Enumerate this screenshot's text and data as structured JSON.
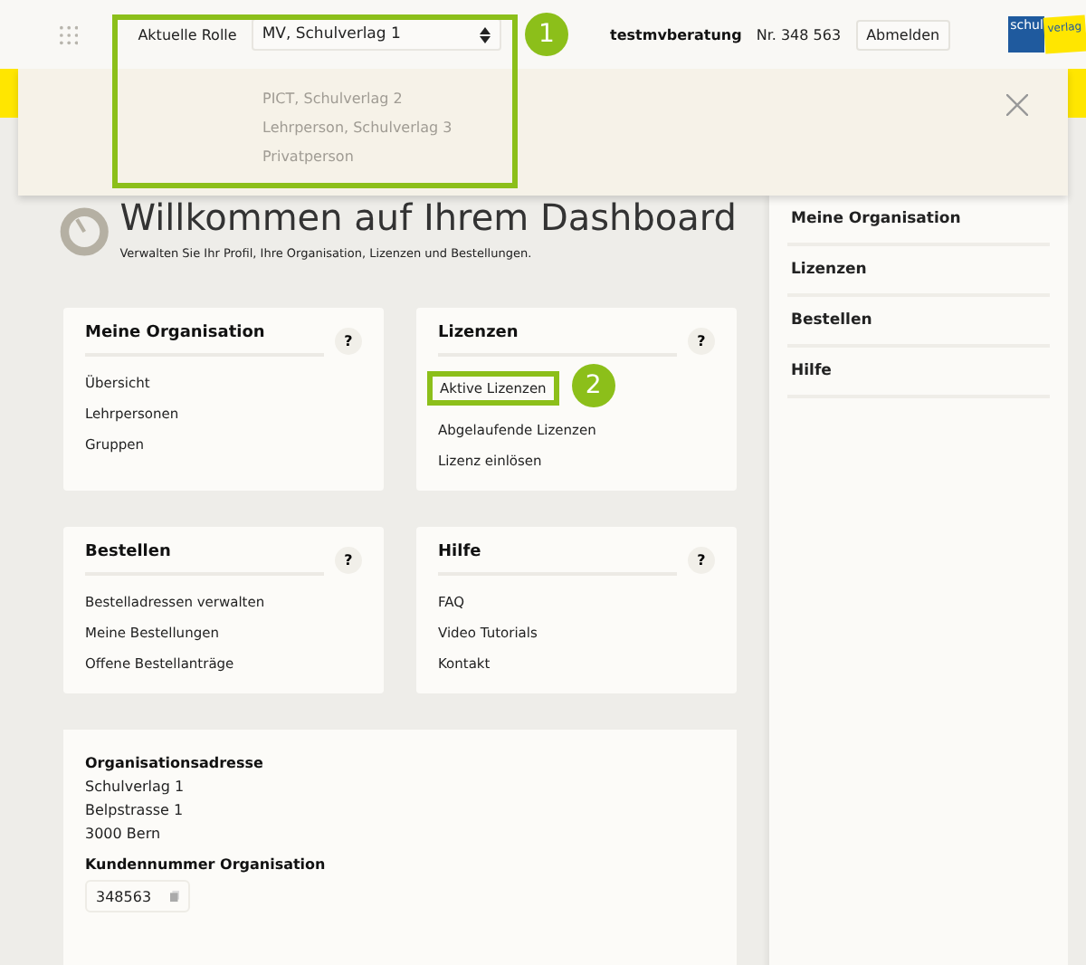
{
  "header": {
    "role_label": "Aktuelle Rolle",
    "current_role": "MV, Schulverlag 1",
    "user": "testmvberatung",
    "customer_no": "Nr. 348 563",
    "logout": "Abmelden",
    "logo": [
      "schul",
      "verlag"
    ],
    "annotation": "1"
  },
  "role_options": [
    "PICT, Schulverlag 2",
    "Lehrperson, Schulverlag 3",
    "Privatperson"
  ],
  "title": "Willkommen auf Ihrem Dashboard",
  "subtitle": "Verwalten Sie Ihr Profil, Ihre Organisation, Lizenzen und Bestellungen.",
  "cards": [
    {
      "title": "Meine Organisation",
      "help": "?",
      "links": [
        {
          "label": "Übersicht",
          "highlighted": false
        },
        {
          "label": "Lehrpersonen",
          "highlighted": false
        },
        {
          "label": "Gruppen",
          "highlighted": false
        }
      ]
    },
    {
      "title": "Lizenzen",
      "help": "?",
      "links": [
        {
          "label": "Aktive Lizenzen",
          "highlighted": true,
          "annotation": "2"
        },
        {
          "label": "Abgelaufende Lizenzen",
          "highlighted": false
        },
        {
          "label": "Lizenz einlösen",
          "highlighted": false
        }
      ]
    },
    {
      "title": "Bestellen",
      "help": "?",
      "links": [
        {
          "label": "Bestelladressen verwalten",
          "highlighted": false
        },
        {
          "label": "Meine Bestellungen",
          "highlighted": false
        },
        {
          "label": "Offene Bestellanträge",
          "highlighted": false
        }
      ]
    },
    {
      "title": "Hilfe",
      "help": "?",
      "links": [
        {
          "label": "FAQ",
          "highlighted": false
        },
        {
          "label": "Video Tutorials",
          "highlighted": false
        },
        {
          "label": "Kontakt",
          "highlighted": false
        }
      ]
    }
  ],
  "address": {
    "heading": "Organisationsadresse",
    "lines": [
      "Schulverlag 1",
      "Belpstrasse 1",
      "3000 Bern"
    ],
    "customer_heading": "Kundennummer Organisation",
    "customer_no": "348563"
  },
  "sidebar": [
    "Meine Organisation",
    "Lizenzen",
    "Bestellen",
    "Hilfe"
  ]
}
